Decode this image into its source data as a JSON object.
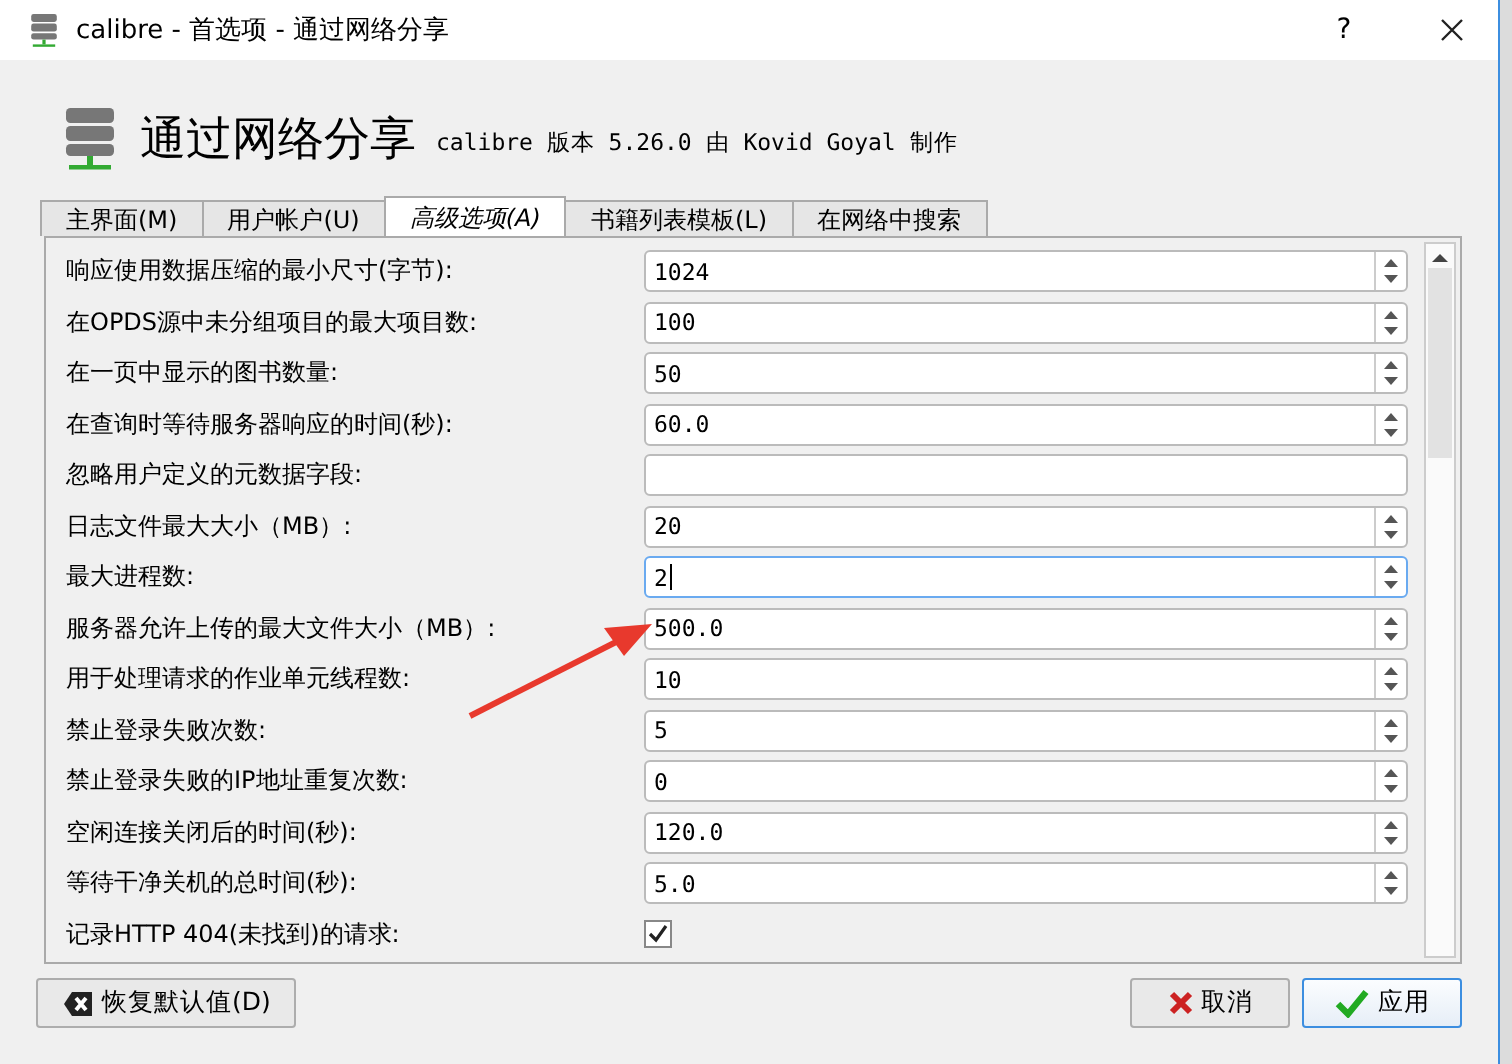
{
  "window": {
    "title": "calibre - 首选项 - 通过网络分享",
    "help": "?"
  },
  "header": {
    "title": "通过网络分享",
    "subtitle": "calibre 版本 5.26.0 由 Kovid Goyal 制作"
  },
  "tabs": [
    {
      "label": "主界面(M)",
      "selected": false
    },
    {
      "label": "用户帐户(U)",
      "selected": false
    },
    {
      "label": "高级选项(A)",
      "selected": true
    },
    {
      "label": "书籍列表模板(L)",
      "selected": false
    },
    {
      "label": "在网络中搜索",
      "selected": false
    }
  ],
  "options": [
    {
      "kind": "spin",
      "label": "响应使用数据压缩的最小尺寸(字节):",
      "value": "1024",
      "focused": false
    },
    {
      "kind": "spin",
      "label": "在OPDS源中未分组项目的最大项目数:",
      "value": "100",
      "focused": false
    },
    {
      "kind": "spin",
      "label": "在一页中显示的图书数量:",
      "value": "50",
      "focused": false
    },
    {
      "kind": "spin",
      "label": "在查询时等待服务器响应的时间(秒):",
      "value": "60.0",
      "focused": false
    },
    {
      "kind": "text",
      "label": "忽略用户定义的元数据字段:",
      "focused": false
    },
    {
      "kind": "spin",
      "label": "日志文件最大大小（MB）:",
      "value": "20",
      "focused": false
    },
    {
      "kind": "spin",
      "label": "最大进程数:",
      "value": "2",
      "focused": true
    },
    {
      "kind": "spin",
      "label": "服务器允许上传的最大文件大小（MB）:",
      "value": "500.0",
      "focused": false
    },
    {
      "kind": "spin",
      "label": "用于处理请求的作业单元线程数:",
      "value": "10",
      "focused": false
    },
    {
      "kind": "spin",
      "label": "禁止登录失败次数:",
      "value": "5",
      "focused": false
    },
    {
      "kind": "spin",
      "label": "禁止登录失败的IP地址重复次数:",
      "value": "0",
      "focused": false
    },
    {
      "kind": "spin",
      "label": "空闲连接关闭后的时间(秒):",
      "value": "120.0",
      "focused": false
    },
    {
      "kind": "spin",
      "label": "等待干净关机的总时间(秒):",
      "value": "5.0",
      "focused": false
    },
    {
      "kind": "check",
      "label": "记录HTTP 404(未找到)的请求:",
      "checked": true
    }
  ],
  "buttons": [
    {
      "kind": "restore",
      "label": "恢复默认值(D)",
      "default": false
    },
    {
      "kind": "cancel",
      "label": "取消",
      "default": false
    },
    {
      "kind": "apply",
      "label": "应用",
      "default": true
    }
  ]
}
